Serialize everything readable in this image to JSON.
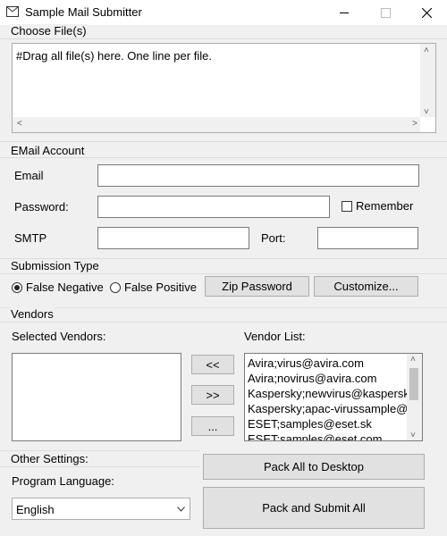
{
  "window": {
    "title": "Sample Mail Submitter"
  },
  "choose_files": {
    "legend": "Choose File(s)",
    "text": "#Drag all file(s) here. One line per file."
  },
  "email_account": {
    "legend": "EMail Account",
    "email_label": "Email",
    "email_value": "",
    "password_label": "Password:",
    "password_value": "",
    "remember_label": "Remember",
    "remember_checked": false,
    "smtp_label": "SMTP",
    "smtp_value": "",
    "port_label": "Port:",
    "port_value": ""
  },
  "submission_type": {
    "legend": "Submission Type",
    "false_negative_label": "False Negative",
    "false_positive_label": "False Positive",
    "selected": "False Negative",
    "zip_password_label": "Zip Password",
    "customize_label": "Customize..."
  },
  "vendors": {
    "legend": "Vendors",
    "selected_label": "Selected Vendors:",
    "selected_vendors": [],
    "list_label": "Vendor List:",
    "vendor_list": [
      "Avira;virus@avira.com",
      "Avira;novirus@avira.com",
      "Kaspersky;newvirus@kaspersk",
      "Kaspersky;apac-virussample@",
      "ESET;samples@eset.sk",
      "ESET;samples@eset.com"
    ],
    "move_left_label": "<<",
    "move_right_label": ">>",
    "more_label": "..."
  },
  "other_settings": {
    "legend": "Other Settings:",
    "language_label": "Program Language:",
    "language_value": "English",
    "pack_desktop_label": "Pack All to Desktop",
    "pack_submit_label": "Pack and Submit All"
  },
  "icons": {
    "app": "mail-icon",
    "minimize": "minimize-icon",
    "maximize": "maximize-icon",
    "close": "close-icon"
  }
}
